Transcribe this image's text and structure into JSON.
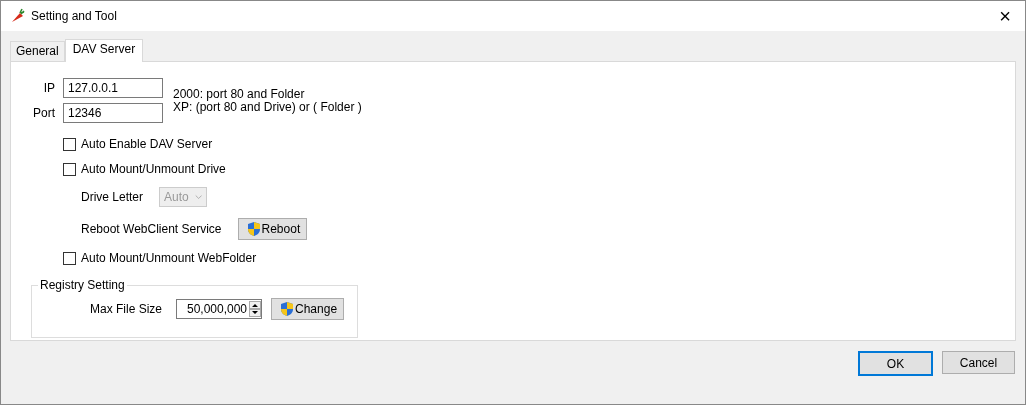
{
  "window": {
    "title": "Setting and Tool",
    "close": "×"
  },
  "tabs": [
    {
      "label": "General",
      "selected": false
    },
    {
      "label": "DAV Server",
      "selected": true
    }
  ],
  "fields": [
    {
      "label": "IP",
      "value": "127.0.0.1"
    },
    {
      "label": "Port",
      "value": "12346"
    }
  ],
  "notes": [
    "2000: port 80 and Folder",
    "XP: (port 80 and Drive) or ( Folder )"
  ],
  "options": [
    {
      "kind": "checkbox",
      "label": "Auto Enable DAV Server",
      "checked": false
    },
    {
      "kind": "checkbox",
      "label": "Auto Mount/Unmount Drive",
      "checked": false
    },
    {
      "kind": "select",
      "label": "Drive Letter",
      "value": "Auto",
      "disabled": true
    },
    {
      "kind": "button",
      "label": "Reboot WebClient Service",
      "button": "Reboot"
    },
    {
      "kind": "checkbox",
      "label": "Auto Mount/Unmount WebFolder",
      "checked": false
    }
  ],
  "registry": {
    "title": "Registry Setting",
    "label": "Max File Size",
    "value": "50,000,000",
    "button": "Change"
  },
  "buttons": [
    {
      "label": "OK",
      "default": true
    },
    {
      "label": "Cancel",
      "default": false
    }
  ]
}
